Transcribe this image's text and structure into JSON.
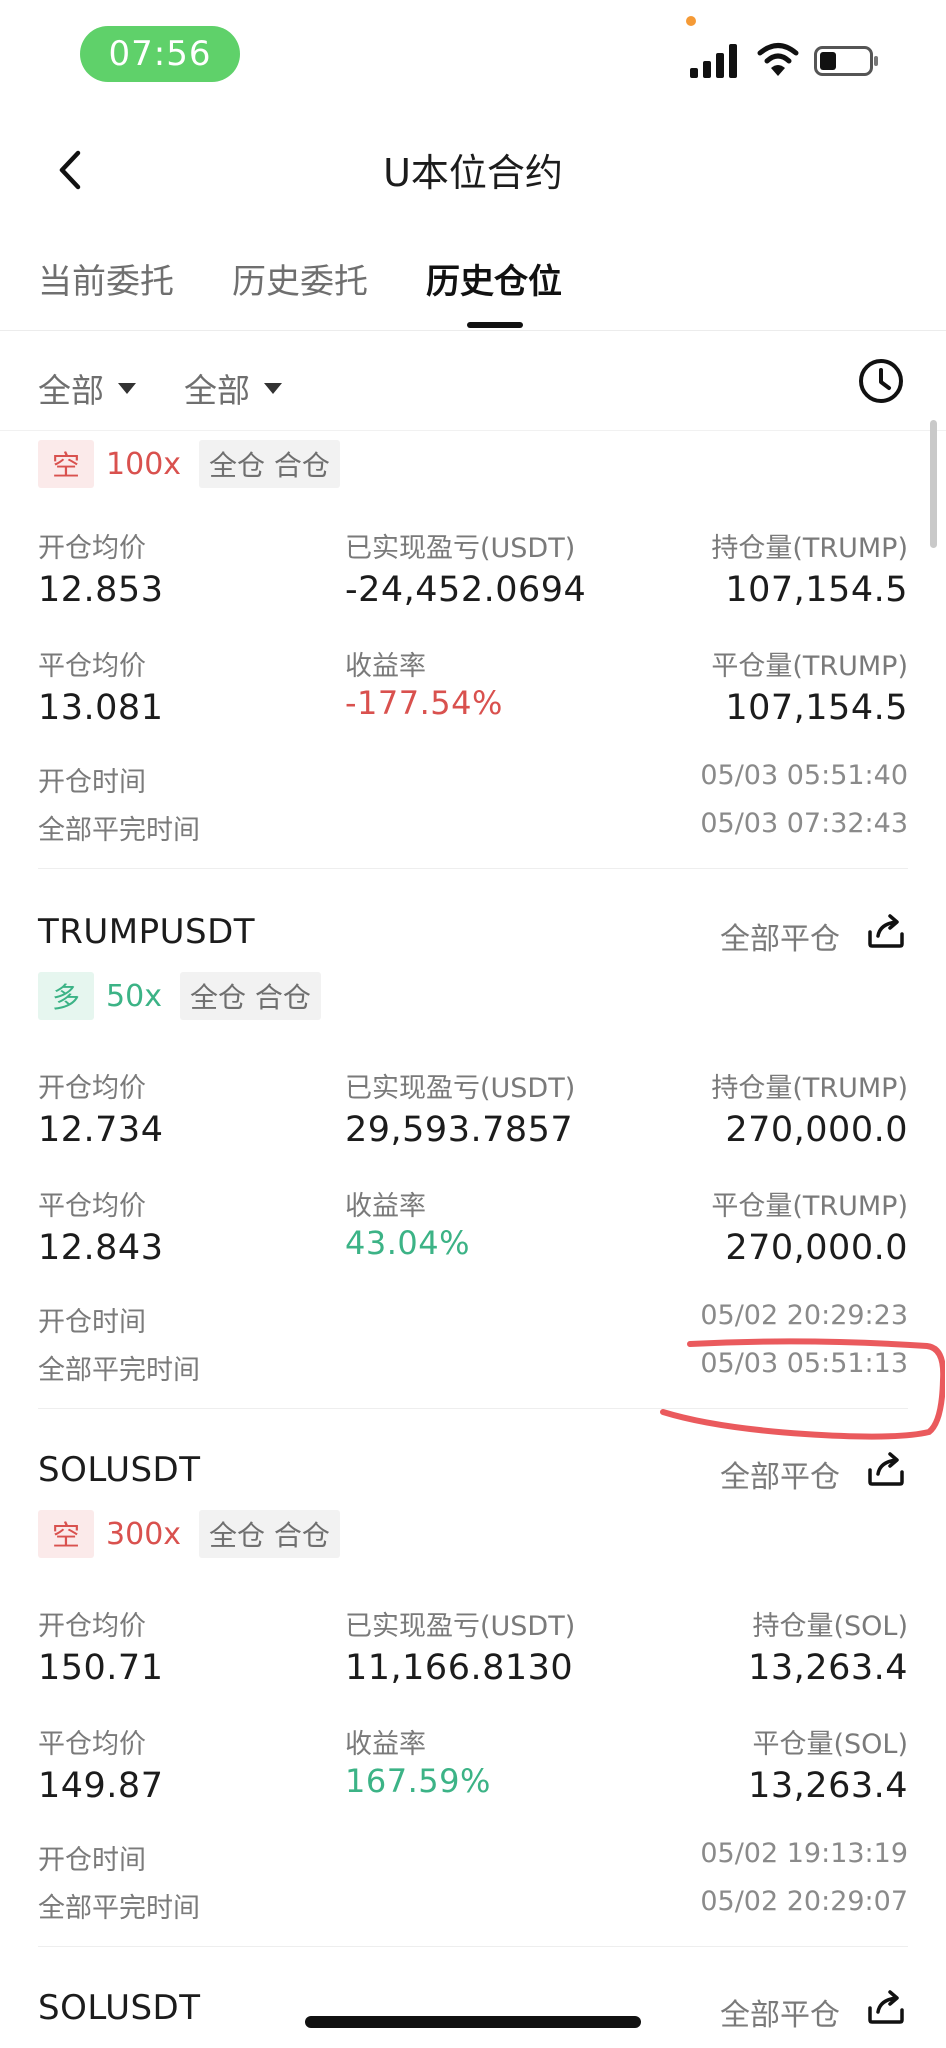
{
  "status_bar": {
    "time": "07:56"
  },
  "nav": {
    "title": "U本位合约"
  },
  "tabs": [
    {
      "label": "当前委托"
    },
    {
      "label": "历史委托"
    },
    {
      "label": "历史仓位"
    }
  ],
  "filters": [
    {
      "label": "全部"
    },
    {
      "label": "全部"
    }
  ],
  "labels": {
    "open_avg": "开仓均价",
    "close_avg": "平仓均价",
    "open_time": "开仓时间",
    "close_time": "全部平完时间",
    "close_all": "全部平仓",
    "mode": "全仓 合仓"
  },
  "positions": [
    {
      "direction": "空",
      "leverage": "100x",
      "open_price": "12.853",
      "close_price": "13.081",
      "pnl_label": "已实现盈亏(USDT)",
      "pnl": "-24,452.0694",
      "roe_label": "收益率",
      "roe": "-177.54%",
      "hold_label": "持仓量(TRUMP)",
      "hold": "107,154.5",
      "closed_label": "平仓量(TRUMP)",
      "closed": "107,154.5",
      "open_time": "05/03 05:51:40",
      "close_time": "05/03 07:32:43"
    },
    {
      "symbol": "TRUMPUSDT",
      "direction": "多",
      "leverage": "50x",
      "open_price": "12.734",
      "close_price": "12.843",
      "pnl_label": "已实现盈亏(USDT)",
      "pnl": "29,593.7857",
      "roe_label": "收益率",
      "roe": "43.04%",
      "hold_label": "持仓量(TRUMP)",
      "hold": "270,000.0",
      "closed_label": "平仓量(TRUMP)",
      "closed": "270,000.0",
      "open_time": "05/02 20:29:23",
      "close_time": "05/03 05:51:13"
    },
    {
      "symbol": "SOLUSDT",
      "direction": "空",
      "leverage": "300x",
      "open_price": "150.71",
      "close_price": "149.87",
      "pnl_label": "已实现盈亏(USDT)",
      "pnl": "11,166.8130",
      "roe_label": "收益率",
      "roe": "167.59%",
      "hold_label": "持仓量(SOL)",
      "hold": "13,263.4",
      "closed_label": "平仓量(SOL)",
      "closed": "13,263.4",
      "open_time": "05/02 19:13:19",
      "close_time": "05/02 20:29:07"
    },
    {
      "symbol": "SOLUSDT"
    }
  ],
  "colors": {
    "short": "#d9514e",
    "long": "#3cb386",
    "status_pill": "#5fd16a",
    "annotation": "#e8484b"
  }
}
